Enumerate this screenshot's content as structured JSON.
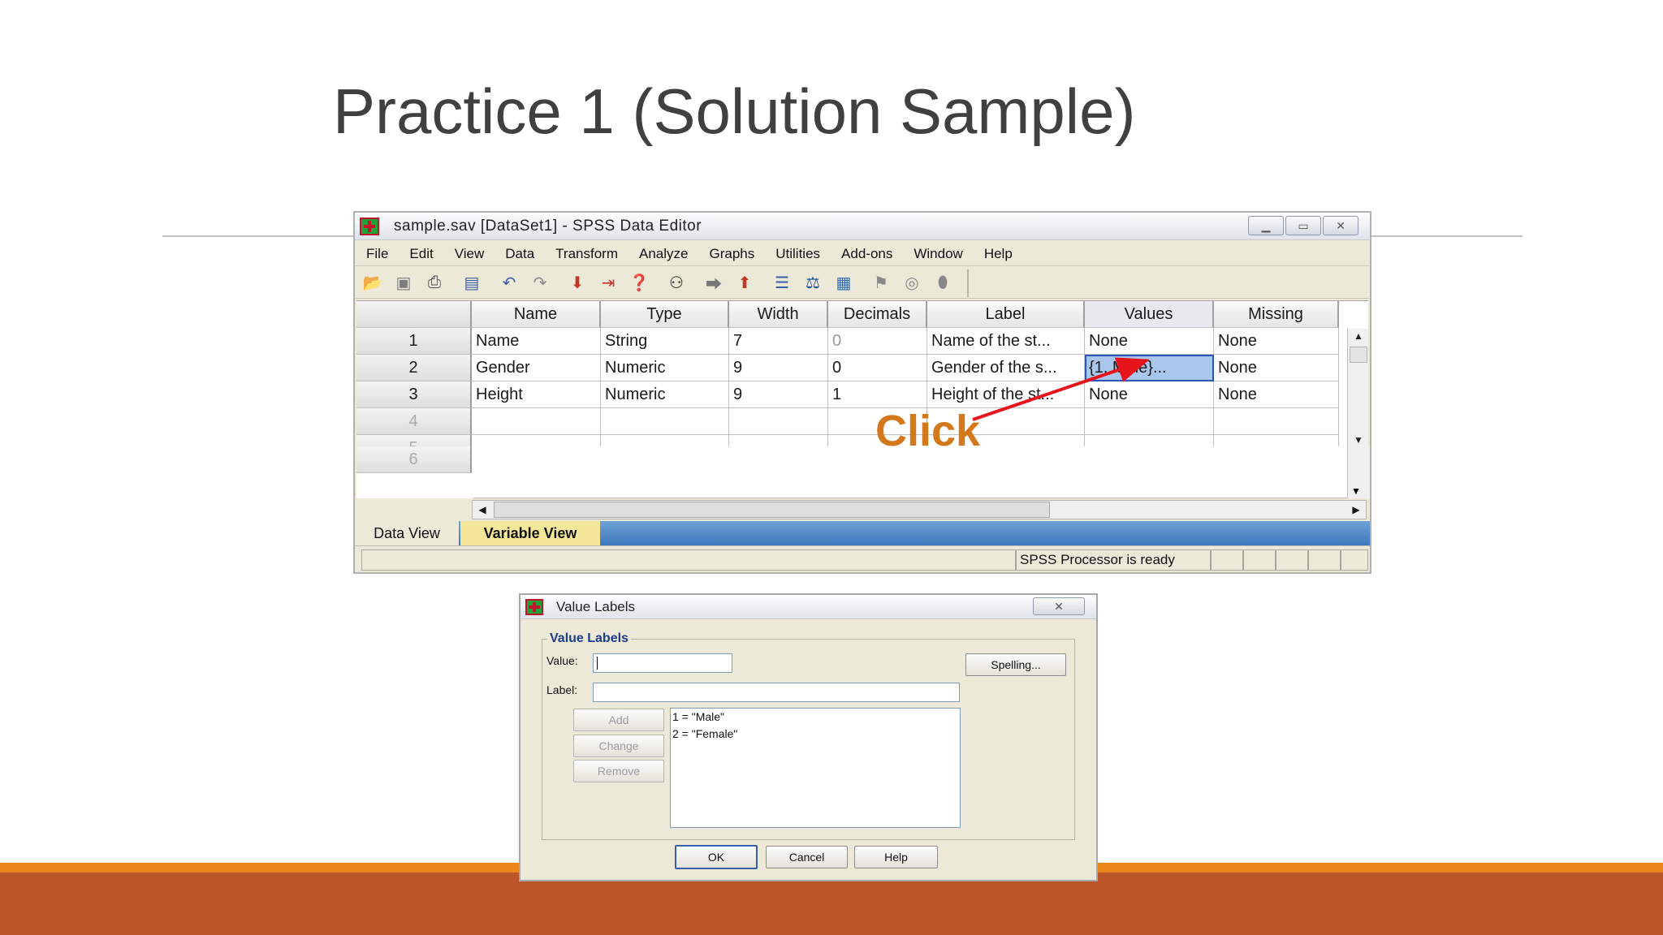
{
  "slide": {
    "title": "Practice 1 (Solution Sample)"
  },
  "spss": {
    "window_title": "sample.sav [DataSet1] - SPSS Data Editor",
    "menu": [
      "File",
      "Edit",
      "View",
      "Data",
      "Transform",
      "Analyze",
      "Graphs",
      "Utilities",
      "Add-ons",
      "Window",
      "Help"
    ],
    "columns": [
      "Name",
      "Type",
      "Width",
      "Decimals",
      "Label",
      "Values",
      "Missing"
    ],
    "rows": [
      {
        "num": "1",
        "name": "Name",
        "type": "String",
        "width": "7",
        "decimals": "0",
        "label": "Name of the st...",
        "values": "None",
        "missing": "None"
      },
      {
        "num": "2",
        "name": "Gender",
        "type": "Numeric",
        "width": "9",
        "decimals": "0",
        "label": "Gender of the s...",
        "values": "{1, Male}...",
        "missing": "None"
      },
      {
        "num": "3",
        "name": "Height",
        "type": "Numeric",
        "width": "9",
        "decimals": "1",
        "label": "Height of the st...",
        "values": "None",
        "missing": "None"
      }
    ],
    "empty_rows": [
      "4",
      "5",
      "6"
    ],
    "tabs": {
      "data_view": "Data View",
      "variable_view": "Variable View"
    },
    "status": "SPSS  Processor is ready",
    "annotation": "Click",
    "annotation_color": "#d4781c",
    "arrow_color": "#e8141c"
  },
  "dialog": {
    "title": "Value Labels",
    "group_title": "Value Labels",
    "value_label": "Value:",
    "label_label": "Label:",
    "spelling": "Spelling...",
    "add": "Add",
    "change": "Change",
    "remove": "Remove",
    "list_items": [
      "1 = \"Male\"",
      "2 = \"Female\""
    ],
    "ok": "OK",
    "cancel": "Cancel",
    "help": "Help"
  },
  "colors": {
    "band_top": "#e9861c",
    "band_bottom": "#bc562a",
    "selected_cell": "#a9c6ec"
  }
}
